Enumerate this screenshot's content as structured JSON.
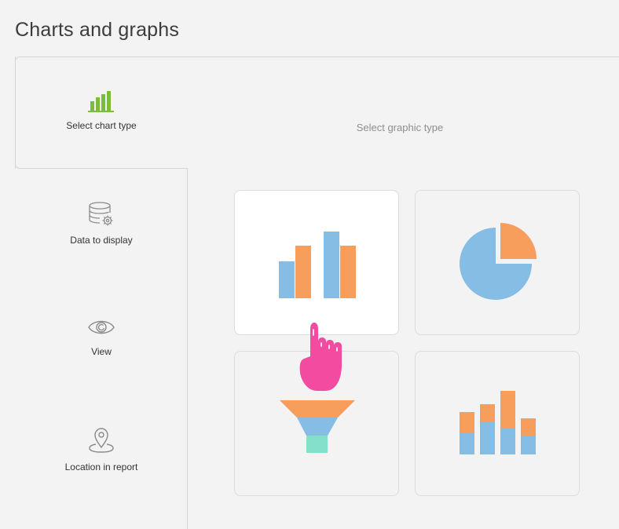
{
  "page": {
    "title": "Charts and graphs"
  },
  "steps": [
    {
      "label": "Select chart type",
      "icon": "bar-chart-icon",
      "active": true
    },
    {
      "label": "Data to display",
      "icon": "database-settings-icon"
    },
    {
      "label": "View",
      "icon": "eye-icon"
    },
    {
      "label": "Location in report",
      "icon": "map-pin-icon"
    }
  ],
  "main": {
    "heading": "Select graphic type",
    "options": [
      {
        "icon": "grouped-bar-chart-icon",
        "selected": true
      },
      {
        "icon": "pie-chart-icon",
        "selected": false
      },
      {
        "icon": "funnel-chart-icon",
        "selected": false
      },
      {
        "icon": "stacked-bar-chart-icon",
        "selected": false
      }
    ]
  },
  "colors": {
    "blue": "#85bde4",
    "orange": "#f79e5c",
    "teal": "#84e0c8",
    "green_icon": "#7bbc3c",
    "pointer": "#f24ba0"
  }
}
